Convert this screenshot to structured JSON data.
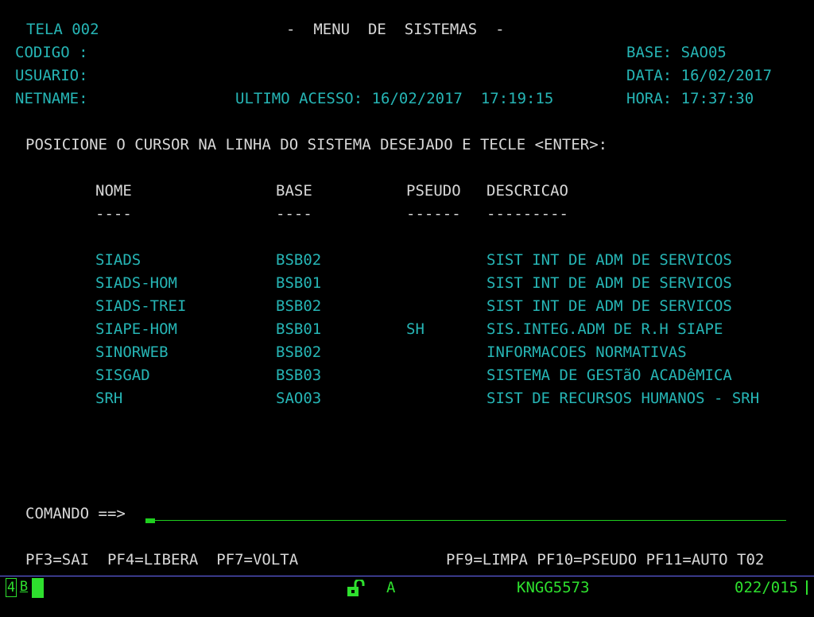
{
  "header": {
    "screen_id": "TELA 002",
    "title": "-  MENU  DE  SISTEMAS  -",
    "codigo_label": "CODIGO :",
    "usuario_label": "USUARIO:",
    "netname_label": "NETNAME:",
    "ultimo_acesso": "ULTIMO ACESSO: 16/02/2017  17:19:15",
    "base": "BASE: SAO05",
    "data": "DATA: 16/02/2017",
    "hora": "HORA: 17:37:30"
  },
  "instruction": "POSICIONE O CURSOR NA LINHA DO SISTEMA DESEJADO E TECLE <ENTER>:",
  "table": {
    "headers": {
      "nome": "NOME",
      "base": "BASE",
      "pseudo": "PSEUDO",
      "descricao": "DESCRICAO"
    },
    "underlines": {
      "nome": "----",
      "base": "----",
      "pseudo": "------",
      "descricao": "---------"
    },
    "rows": [
      {
        "nome": "SIADS",
        "base": "BSB02",
        "pseudo": "",
        "descricao": "SIST INT DE ADM DE SERVICOS"
      },
      {
        "nome": "SIADS-HOM",
        "base": "BSB01",
        "pseudo": "",
        "descricao": "SIST INT DE ADM DE SERVICOS"
      },
      {
        "nome": "SIADS-TREI",
        "base": "BSB02",
        "pseudo": "",
        "descricao": "SIST INT DE ADM DE SERVICOS"
      },
      {
        "nome": "SIAPE-HOM",
        "base": "BSB01",
        "pseudo": "SH",
        "descricao": "SIS.INTEG.ADM DE R.H SIAPE"
      },
      {
        "nome": "SINORWEB",
        "base": "BSB02",
        "pseudo": "",
        "descricao": "INFORMACOES NORMATIVAS"
      },
      {
        "nome": "SISGAD",
        "base": "BSB03",
        "pseudo": "",
        "descricao": "SISTEMA DE GESTãO ACADêMICA"
      },
      {
        "nome": "SRH",
        "base": "SAO03",
        "pseudo": "",
        "descricao": "SIST DE RECURSOS HUMANOS - SRH"
      }
    ]
  },
  "command": {
    "label": "COMANDO ==>",
    "value": ""
  },
  "function_keys": {
    "left": "PF3=SAI  PF4=LIBERA  PF7=VOLTA",
    "right": "PF9=LIMPA PF10=PSEUDO PF11=AUTO T02"
  },
  "status_bar": {
    "session_number": "4",
    "session_letter": "B",
    "lock_icon": "unlocked-padlock-icon",
    "mode": "A",
    "lu_name": "KNGG5573",
    "cursor_position": "022/015"
  },
  "colors": {
    "background": "#000000",
    "cyan_text": "#26b5b5",
    "white_text": "#d8d8d8",
    "green_text": "#2ee02e",
    "separator": "#6a6aff"
  }
}
